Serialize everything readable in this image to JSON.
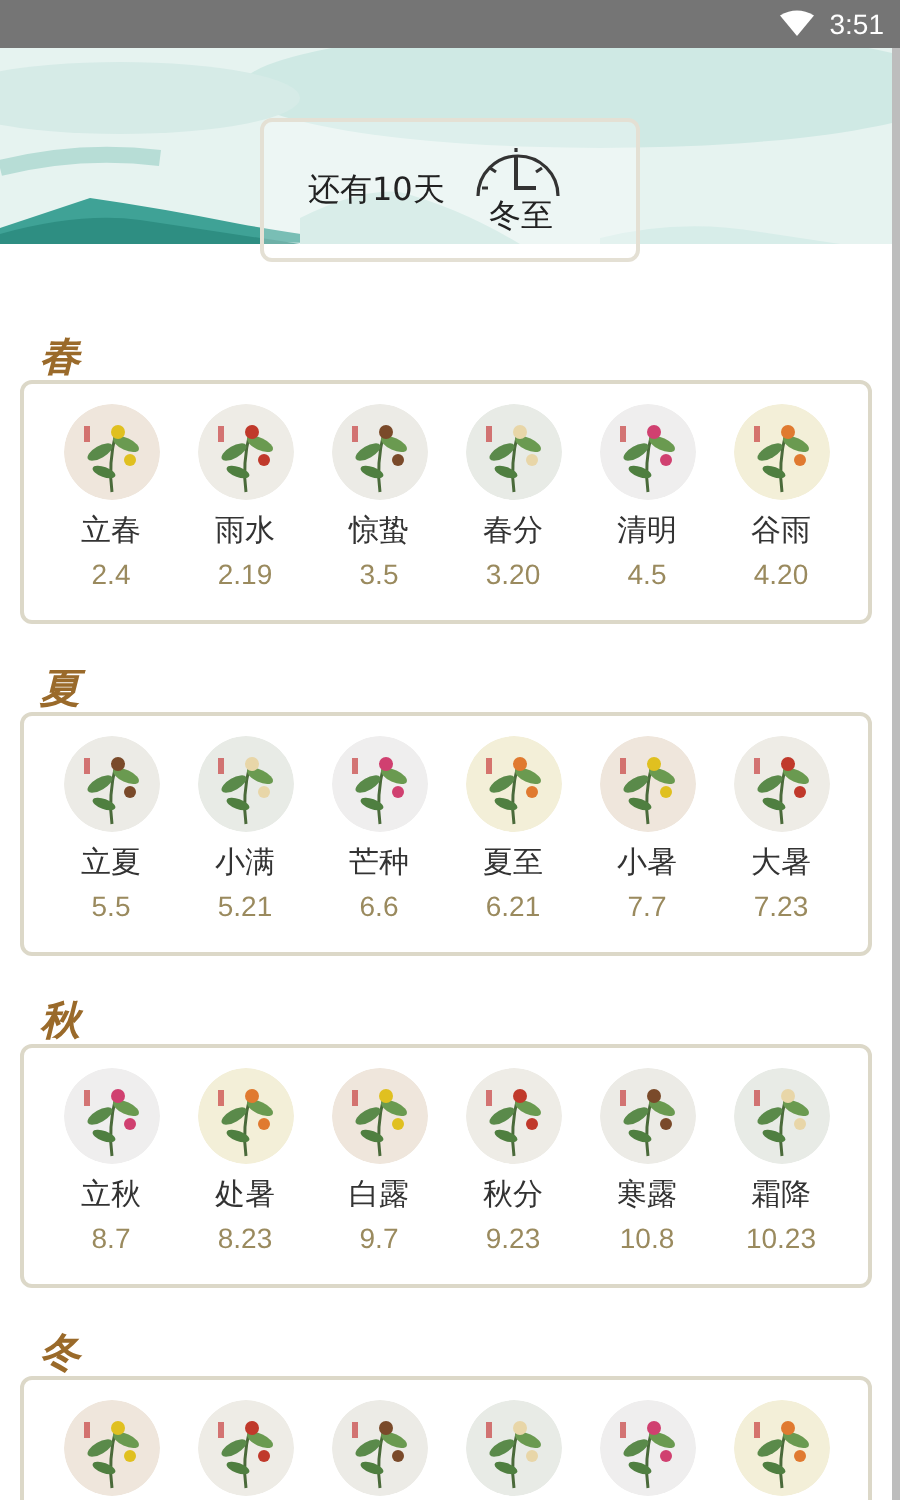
{
  "status_bar": {
    "time": "3:51"
  },
  "countdown": {
    "text": "还有10天",
    "term": "冬至"
  },
  "seasons": [
    {
      "label": "春",
      "terms": [
        {
          "name": "立春",
          "date": "2.4"
        },
        {
          "name": "雨水",
          "date": "2.19"
        },
        {
          "name": "惊蛰",
          "date": "3.5"
        },
        {
          "name": "春分",
          "date": "3.20"
        },
        {
          "name": "清明",
          "date": "4.5"
        },
        {
          "name": "谷雨",
          "date": "4.20"
        }
      ]
    },
    {
      "label": "夏",
      "terms": [
        {
          "name": "立夏",
          "date": "5.5"
        },
        {
          "name": "小满",
          "date": "5.21"
        },
        {
          "name": "芒种",
          "date": "6.6"
        },
        {
          "name": "夏至",
          "date": "6.21"
        },
        {
          "name": "小暑",
          "date": "7.7"
        },
        {
          "name": "大暑",
          "date": "7.23"
        }
      ]
    },
    {
      "label": "秋",
      "terms": [
        {
          "name": "立秋",
          "date": "8.7"
        },
        {
          "name": "处暑",
          "date": "8.23"
        },
        {
          "name": "白露",
          "date": "9.7"
        },
        {
          "name": "秋分",
          "date": "9.23"
        },
        {
          "name": "寒露",
          "date": "10.8"
        },
        {
          "name": "霜降",
          "date": "10.23"
        }
      ]
    },
    {
      "label": "冬"
    }
  ]
}
